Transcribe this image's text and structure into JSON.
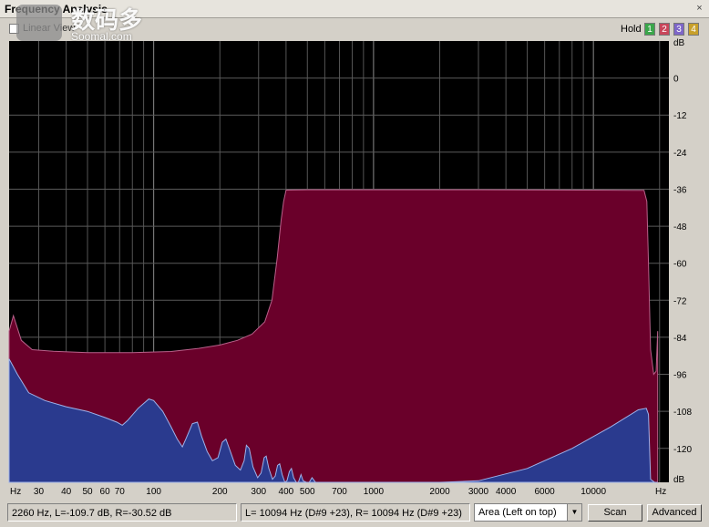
{
  "window": {
    "title": "Frequency Analysis",
    "close_label": "×"
  },
  "toolbar": {
    "linear_view_label": "Linear View",
    "linear_view_checked": false,
    "hold_label": "Hold",
    "hold_buttons": [
      {
        "label": "1",
        "color": "#3aa64a"
      },
      {
        "label": "2",
        "color": "#c8465a"
      },
      {
        "label": "3",
        "color": "#7e66c8"
      },
      {
        "label": "4",
        "color": "#c8a02a"
      }
    ]
  },
  "watermark": {
    "chinese": "数码多",
    "domain": "Soomal.com"
  },
  "chart_data": {
    "type": "area",
    "x_scale": "log",
    "x_unit_label": "Hz",
    "x_range": [
      22,
      22050
    ],
    "x_tick_labels": [
      {
        "value": 30,
        "label": "30"
      },
      {
        "value": 40,
        "label": "40"
      },
      {
        "value": 50,
        "label": "50"
      },
      {
        "value": 60,
        "label": "60"
      },
      {
        "value": 70,
        "label": "70"
      },
      {
        "value": 100,
        "label": "100"
      },
      {
        "value": 200,
        "label": "200"
      },
      {
        "value": 300,
        "label": "300"
      },
      {
        "value": 400,
        "label": "400"
      },
      {
        "value": 500,
        "label": "500"
      },
      {
        "value": 700,
        "label": "700"
      },
      {
        "value": 1000,
        "label": "1000"
      },
      {
        "value": 2000,
        "label": "2000"
      },
      {
        "value": 3000,
        "label": "3000"
      },
      {
        "value": 4000,
        "label": "4000"
      },
      {
        "value": 6000,
        "label": "6000"
      },
      {
        "value": 10000,
        "label": "10000"
      }
    ],
    "y_unit_label": "dB",
    "y_range": [
      -131,
      12
    ],
    "y_ticks": [
      0,
      -12,
      -24,
      -36,
      -48,
      -60,
      -72,
      -84,
      -96,
      -108,
      -120
    ],
    "grid": true,
    "background": "#000000",
    "series": [
      {
        "color": "#6a002a",
        "points": [
          [
            22,
            -82
          ],
          [
            23,
            -77
          ],
          [
            25,
            -85
          ],
          [
            28,
            -88
          ],
          [
            35,
            -88.5
          ],
          [
            50,
            -89
          ],
          [
            80,
            -89
          ],
          [
            120,
            -88.6
          ],
          [
            160,
            -87.6
          ],
          [
            200,
            -86.5
          ],
          [
            240,
            -85
          ],
          [
            280,
            -83
          ],
          [
            320,
            -79
          ],
          [
            345,
            -72
          ],
          [
            365,
            -58
          ],
          [
            380,
            -46
          ],
          [
            390,
            -40
          ],
          [
            400,
            -36.3
          ],
          [
            500,
            -36.2
          ],
          [
            1000,
            -36.2
          ],
          [
            3000,
            -36.2
          ],
          [
            10000,
            -36.3
          ],
          [
            15000,
            -36.4
          ],
          [
            17000,
            -36.4
          ],
          [
            17500,
            -40
          ],
          [
            17800,
            -60
          ],
          [
            18200,
            -88
          ],
          [
            18800,
            -96
          ],
          [
            19300,
            -95
          ],
          [
            19600,
            -82
          ]
        ]
      },
      {
        "color": "#2a3a8e",
        "points": [
          [
            22,
            -91
          ],
          [
            24,
            -96
          ],
          [
            27,
            -102
          ],
          [
            32,
            -104.5
          ],
          [
            40,
            -106.5
          ],
          [
            50,
            -108
          ],
          [
            60,
            -110
          ],
          [
            68,
            -111.5
          ],
          [
            72,
            -112.5
          ],
          [
            76,
            -111
          ],
          [
            85,
            -107
          ],
          [
            95,
            -104
          ],
          [
            100,
            -104.5
          ],
          [
            110,
            -108
          ],
          [
            120,
            -113
          ],
          [
            128,
            -117
          ],
          [
            135,
            -119.5
          ],
          [
            140,
            -117
          ],
          [
            150,
            -112
          ],
          [
            158,
            -111.5
          ],
          [
            165,
            -116
          ],
          [
            175,
            -121
          ],
          [
            185,
            -124
          ],
          [
            196,
            -123
          ],
          [
            205,
            -118
          ],
          [
            213,
            -117
          ],
          [
            222,
            -120.5
          ],
          [
            235,
            -125.5
          ],
          [
            248,
            -127
          ],
          [
            258,
            -124
          ],
          [
            264,
            -119
          ],
          [
            272,
            -120
          ],
          [
            283,
            -126
          ],
          [
            297,
            -129.5
          ],
          [
            308,
            -128
          ],
          [
            318,
            -123
          ],
          [
            325,
            -122.5
          ],
          [
            334,
            -126.5
          ],
          [
            347,
            -130
          ],
          [
            357,
            -129
          ],
          [
            366,
            -125.5
          ],
          [
            374,
            -125
          ],
          [
            384,
            -128.5
          ],
          [
            395,
            -131
          ],
          [
            404,
            -130.5
          ],
          [
            414,
            -127.5
          ],
          [
            423,
            -126.5
          ],
          [
            433,
            -129.5
          ],
          [
            445,
            -131.5
          ],
          [
            455,
            -131
          ],
          [
            468,
            -128.5
          ],
          [
            478,
            -130.5
          ],
          [
            495,
            -132
          ],
          [
            510,
            -131
          ],
          [
            525,
            -129.5
          ],
          [
            545,
            -131.5
          ],
          [
            570,
            -132.5
          ],
          [
            600,
            -132.3
          ],
          [
            700,
            -132.5
          ],
          [
            1000,
            -132.5
          ],
          [
            1500,
            -132.5
          ],
          [
            2000,
            -132
          ],
          [
            3000,
            -130.5
          ],
          [
            5000,
            -126.5
          ],
          [
            8000,
            -120
          ],
          [
            12000,
            -113
          ],
          [
            16000,
            -107.5
          ],
          [
            17400,
            -107
          ],
          [
            17800,
            -109
          ],
          [
            18200,
            -130
          ],
          [
            19000,
            -131
          ],
          [
            19600,
            -133
          ]
        ]
      }
    ]
  },
  "status": {
    "cursor_info": "2260 Hz, L=-109.7 dB, R=-30.52 dB",
    "peak_info": "L=  10094 Hz (D#9 +23), R=  10094 Hz (D#9 +23)",
    "view_mode": "Area (Left on top)",
    "scan_label": "Scan",
    "advanced_label": "Advanced"
  }
}
